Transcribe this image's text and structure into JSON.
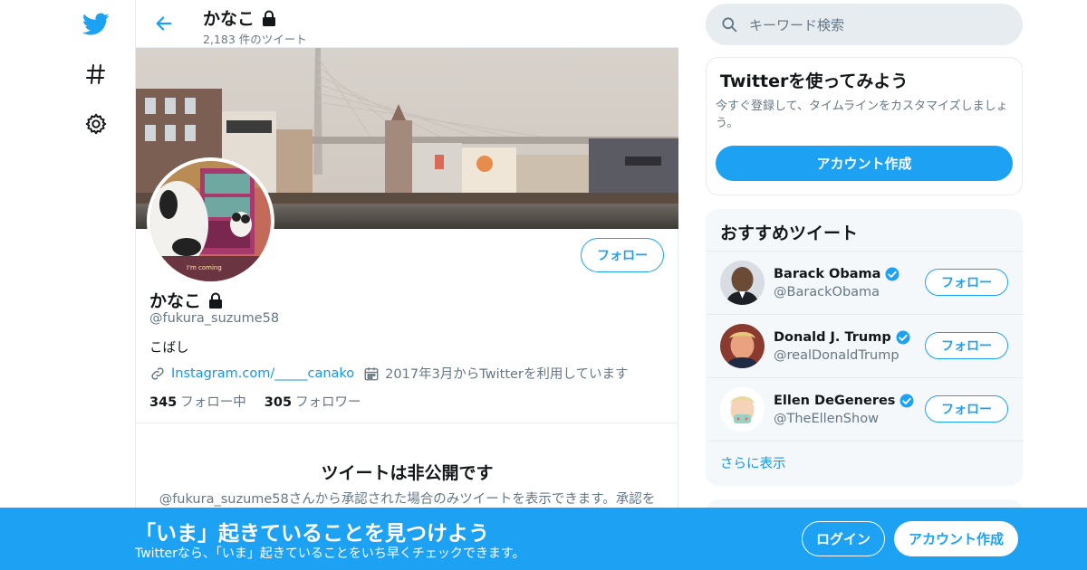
{
  "colors": {
    "brand": "#1da1f2",
    "link": "#1b95e0",
    "muted": "#657786"
  },
  "nav": {
    "icons": [
      "twitter-logo-icon",
      "hashtag-icon",
      "gear-icon"
    ]
  },
  "header": {
    "name": "かなこ",
    "tweet_count": "2,183 件のツイート"
  },
  "profile": {
    "name": "かなこ",
    "handle": "@fukura_suzume58",
    "bio": "こばし",
    "link_text": "Instagram.com/_____canako",
    "joined": "2017年3月からTwitterを利用しています",
    "following_count": "345",
    "following_label": "フォロー中",
    "followers_count": "305",
    "followers_label": "フォロワー",
    "follow_label": "フォロー",
    "avatar_text": "I'm coming"
  },
  "private": {
    "title": "ツイートは非公開です",
    "desc": "@fukura_suzume58さんから承認された場合のみツイートを表示できます。承認を"
  },
  "search": {
    "placeholder": "キーワード検索"
  },
  "signup_card": {
    "title": "Twitterを使ってみよう",
    "desc": "今すぐ登録して、タイムラインをカスタマイズしましょう。",
    "button": "アカウント作成"
  },
  "recommend": {
    "title": "おすすめツイート",
    "users": [
      {
        "name": "Barack Obama",
        "handle": "@BarackObama",
        "button": "フォロー"
      },
      {
        "name": "Donald J. Trump",
        "handle": "@realDonaldTrump",
        "button": "フォロー"
      },
      {
        "name": "Ellen DeGeneres",
        "handle": "@TheEllenShow",
        "button": "フォロー"
      }
    ],
    "more": "さらに表示"
  },
  "bottombar": {
    "title": "「いま」起きていることを見つけよう",
    "subtitle": "Twitterなら、「いま」起きていることをいち早くチェックできます。",
    "login": "ログイン",
    "signup": "アカウント作成"
  }
}
